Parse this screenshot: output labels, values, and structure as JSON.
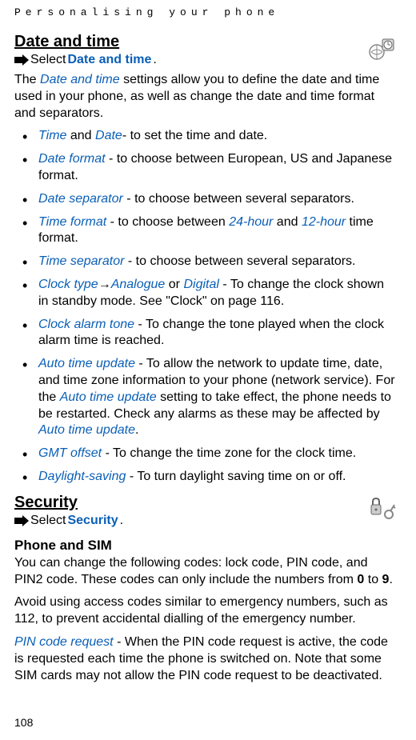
{
  "chapter": "Personalising your phone",
  "pageNumber": "108",
  "sections": {
    "dateTime": {
      "heading": "Date and time",
      "selectPrefix": "Select ",
      "selectTarget": "Date and time",
      "selectPeriod": ".",
      "intro1a": "The ",
      "intro1b": "Date and time",
      "intro1c": " settings allow you to define the date and time used in your phone, as well as change the date and time format and separators.",
      "bullets": [
        {
          "a": "Time",
          "a2": " and ",
          "a3": "Date",
          "rest": "- to set the time and date."
        },
        {
          "a": "Date format",
          "rest": " - to choose between European, US and Japanese format."
        },
        {
          "a": "Date separator",
          "rest": " - to choose between several separators."
        },
        {
          "a": "Time format",
          "mid1": " - to choose between ",
          "b": "24-hour",
          "mid2": " and ",
          "c": "12-hour",
          "rest": " time format."
        },
        {
          "a": "Time separator",
          "rest": " - to choose between several separators."
        },
        {
          "a": "Clock type",
          "arrow": "→",
          "b": "Analogue",
          "mid1": " or ",
          "c": "Digital",
          "rest": " - To change the clock shown in standby mode. See \"Clock\" on page 116."
        },
        {
          "a": "Clock alarm tone",
          "rest": " - To change the tone played when the clock alarm time is reached."
        },
        {
          "a": "Auto time update",
          "mid1": " - To allow the network to update time, date, and time zone information to your phone (network service). For the ",
          "b": "Auto time update",
          "mid2": " setting to take effect, the phone needs to be restarted. Check any alarms as these may be affected by ",
          "c": "Auto time update",
          "rest": "."
        },
        {
          "a": "GMT offset",
          "rest": " - To change the time zone for the clock time."
        },
        {
          "a": "Daylight-saving",
          "rest": " - To turn daylight saving time on or off."
        }
      ]
    },
    "security": {
      "heading": "Security",
      "selectPrefix": "Select ",
      "selectTarget": "Security",
      "selectPeriod": ".",
      "subheading": "Phone and SIM",
      "p1a": "You can change the following codes: lock code, PIN code, and PIN2 code. These codes can only include the numbers from ",
      "p1b": "0",
      "p1c": " to ",
      "p1d": "9",
      "p1e": ".",
      "p2": "Avoid using access codes similar to emergency numbers, such as 112, to prevent accidental dialling of the emergency number.",
      "p3a": "PIN code request",
      "p3b": " - When the PIN code request is active, the code is requested each time the phone is switched on. Note that some SIM cards may not allow the PIN code request to be deactivated."
    }
  }
}
